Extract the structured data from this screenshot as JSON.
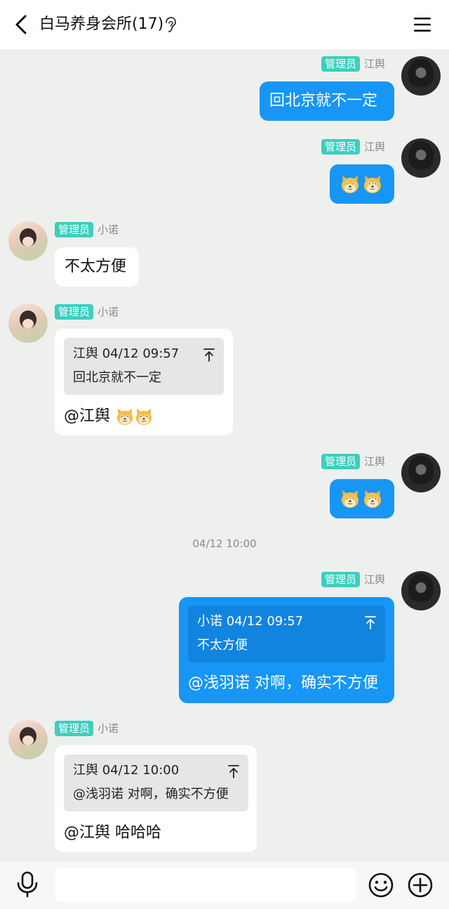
{
  "header": {
    "title": "白马养身会所(17)",
    "back_icon": "chevron-left-icon",
    "ear_icon": "ear-icon",
    "menu_icon": "hamburger-menu-icon"
  },
  "messages": [
    {
      "side": "right",
      "badge": "管理员",
      "name": "江舆",
      "text": "回北京就不一定"
    },
    {
      "side": "right",
      "badge": "管理员",
      "name": "江舆",
      "emoji": [
        "doge-icon",
        "doge-icon"
      ]
    },
    {
      "side": "left",
      "badge": "管理员",
      "name": "小诺",
      "text": "不太方便"
    },
    {
      "side": "left",
      "badge": "管理员",
      "name": "小诺",
      "quote": {
        "head": "江舆 04/12 09:57",
        "body": "回北京就不一定"
      },
      "text": "@江舆",
      "emoji": [
        "doge-icon",
        "doge-icon"
      ]
    },
    {
      "side": "right",
      "badge": "管理员",
      "name": "江舆",
      "emoji": [
        "doge-icon",
        "doge-icon"
      ]
    },
    {
      "side": "right",
      "badge": "管理员",
      "name": "江舆",
      "quote": {
        "head": "小诺 04/12 09:57",
        "body": "不太方便"
      },
      "text": "@浅羽诺 对啊，确实不方便"
    },
    {
      "side": "left",
      "badge": "管理员",
      "name": "小诺",
      "quote": {
        "head": "江舆 04/12 10:00",
        "body": "@浅羽诺 对啊，确实不方便"
      },
      "text": "@江舆 哈哈哈"
    }
  ],
  "timestamp": "04/12 10:00",
  "input": {
    "placeholder": ""
  },
  "colors": {
    "accent": "#1796f5",
    "badge": "#3dcfbf",
    "chat_bg": "#eef0ee"
  }
}
